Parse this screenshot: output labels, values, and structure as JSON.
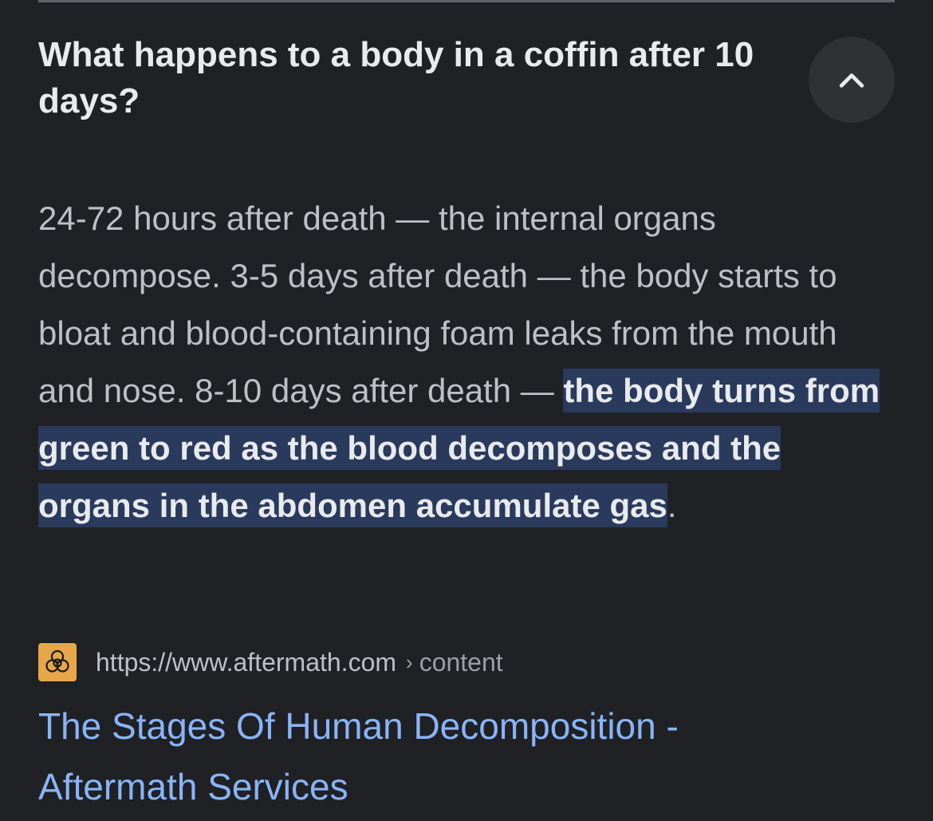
{
  "question": "What happens to a body in a coffin after 10 days?",
  "collapse_icon": "chevron-up-icon",
  "answer": {
    "plain": "24-72 hours after death — the internal organs decompose. 3-5 days after death — the body starts to bloat and blood-containing foam leaks from the mouth and nose. 8-10 days after death — ",
    "highlighted": "the body turns from green to red as the blood decomposes and the organs in the abdomen accumulate gas",
    "trailing": "."
  },
  "source": {
    "favicon": "biohazard-icon",
    "url": "https://www.aftermath.com",
    "separator": "›",
    "path": "content"
  },
  "result_title": "The Stages Of Human Decomposition - Aftermath Services",
  "colors": {
    "background": "#202124",
    "highlight": "#2a3a5c",
    "link": "#8ab4f8",
    "favicon_bg": "#e8a64a"
  }
}
